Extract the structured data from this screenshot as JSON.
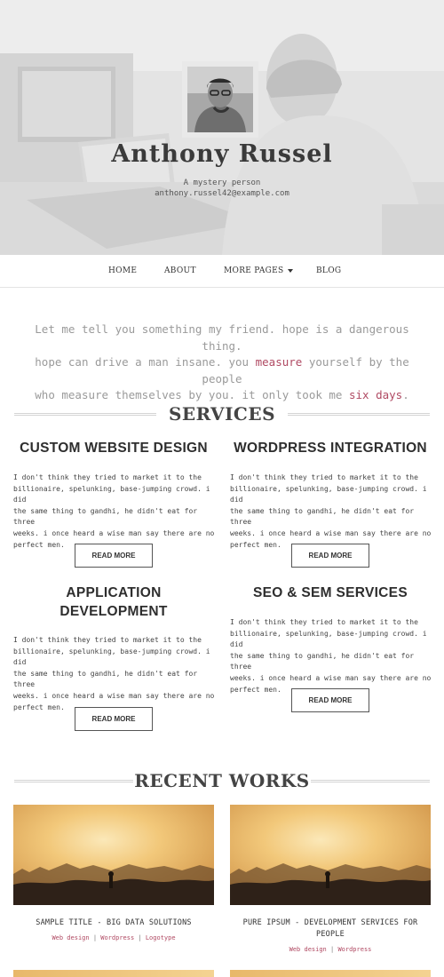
{
  "hero": {
    "name": "Anthony Russel",
    "tagline": "A mystery person",
    "email": "anthony.russel42@example.com"
  },
  "nav": {
    "items": [
      {
        "label": "HOME",
        "active": true
      },
      {
        "label": "ABOUT",
        "active": false
      },
      {
        "label": "MORE PAGES",
        "active": false,
        "dropdown": true
      },
      {
        "label": "BLOG",
        "active": false
      }
    ]
  },
  "quote": {
    "line1": "Let me tell you something my friend. hope is a dangerous thing.",
    "line2_a": "hope can drive a man insane. you ",
    "line2_hl": "measure",
    "line2_b": " yourself by the people",
    "line3_a": "who measure themselves by you. it only took me ",
    "line3_hl": "six days",
    "line3_b": "."
  },
  "services": {
    "heading": "SERVICES",
    "items": [
      {
        "title_line1": "CUSTOM WEBSITE DESIGN",
        "title_line2": "",
        "text": [
          "I don't think they tried to market it to the",
          "billionaire, spelunking, base-jumping crowd. i did",
          "the same thing to gandhi, he didn't eat for three",
          "weeks. i once heard a wise man say there are no",
          "perfect men."
        ],
        "button": "READ MORE"
      },
      {
        "title_line1": "WORDPRESS INTEGRATION",
        "title_line2": "",
        "text": [
          "I don't think they tried to market it to the",
          "billionaire, spelunking, base-jumping crowd. i did",
          "the same thing to gandhi, he didn't eat for three",
          "weeks. i once heard a wise man say there are no",
          "perfect men."
        ],
        "button": "READ MORE"
      },
      {
        "title_line1": "APPLICATION",
        "title_line2": "DEVELOPMENT",
        "text": [
          "I don't think they tried to market it to the",
          "billionaire, spelunking, base-jumping crowd. i did",
          "the same thing to gandhi, he didn't eat for three",
          "weeks. i once heard a wise man say there are no",
          "perfect men."
        ],
        "button": "READ MORE"
      },
      {
        "title_line1": "SEO & SEM SERVICES",
        "title_line2": "",
        "text": [
          "I don't think they tried to market it to the",
          "billionaire, spelunking, base-jumping crowd. i did",
          "the same thing to gandhi, he didn't eat for three",
          "weeks. i once heard a wise man say there are no",
          "perfect men."
        ],
        "button": "READ MORE"
      }
    ]
  },
  "works": {
    "heading": "RECENT WORKS",
    "items": [
      {
        "title_line1": "SAMPLE TITLE - BIG DATA SOLUTIONS",
        "title_line2": "",
        "tags": [
          "Web design",
          "Wordpress",
          "Logotype"
        ]
      },
      {
        "title_line1": "PURE IPSUM - DEVELOPMENT SERVICES FOR",
        "title_line2": "PEOPLE",
        "tags": [
          "Web design",
          "Wordpress"
        ]
      }
    ]
  },
  "colors": {
    "accent": "#b04a63",
    "text": "#333333",
    "muted": "#9a9a9a"
  }
}
